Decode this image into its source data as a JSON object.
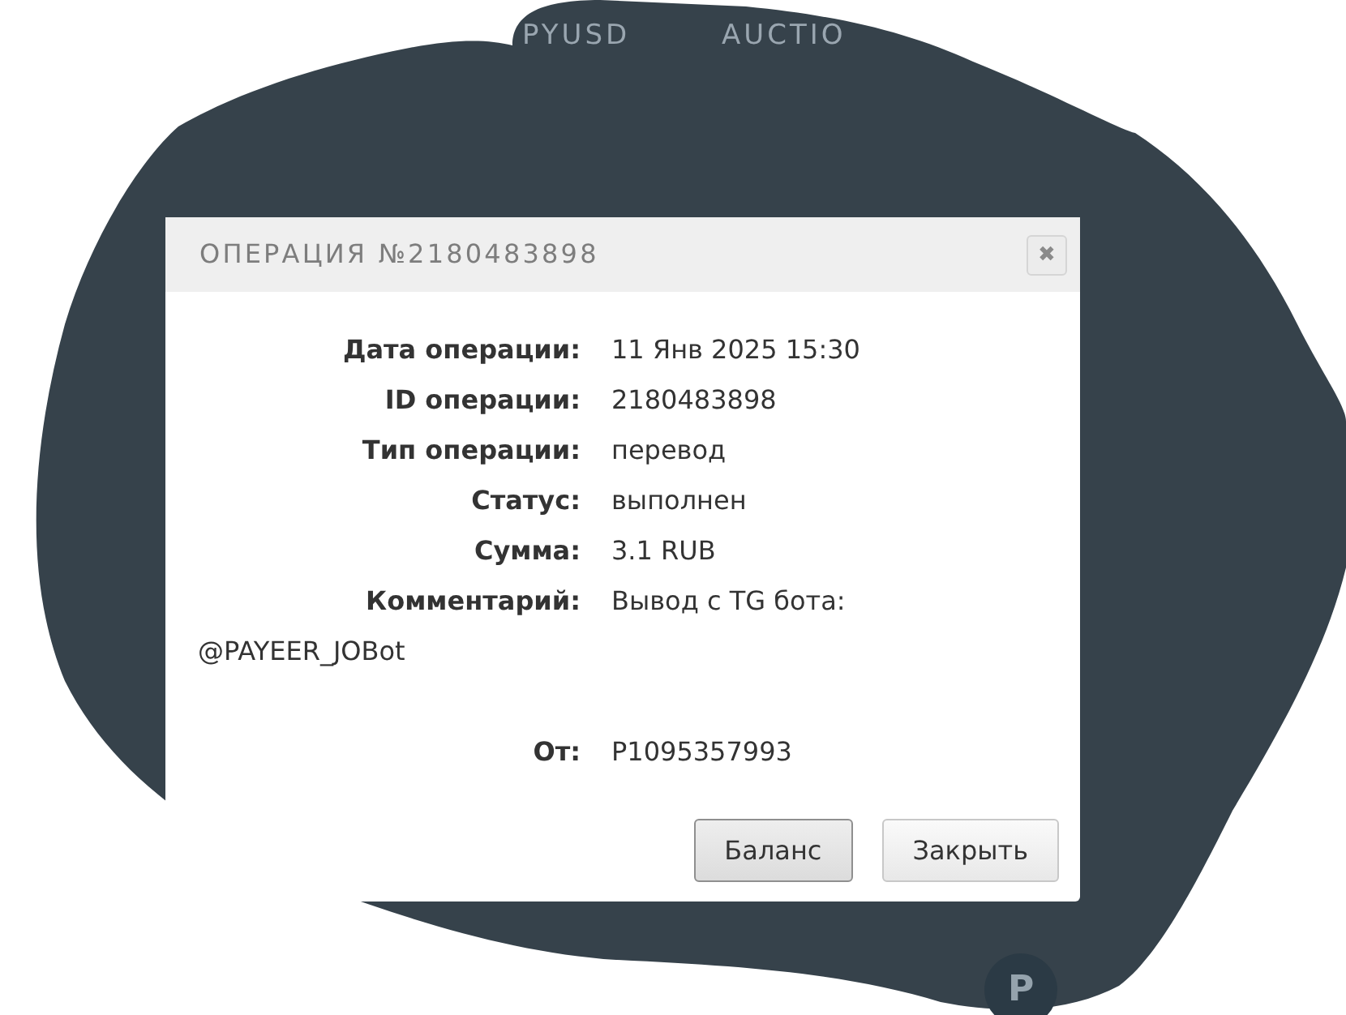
{
  "nav": [
    "PYUSD",
    "AUCTIO"
  ],
  "dialog": {
    "title": "ОПЕРАЦИЯ №2180483898",
    "close": "✖",
    "fields": [
      {
        "label": "Дата операции:",
        "value": "11 Янв 2025 15:30"
      },
      {
        "label": "ID операции:",
        "value": "2180483898"
      },
      {
        "label": "Тип операции:",
        "value": "перевод"
      },
      {
        "label": "Статус:",
        "value": "выполнен"
      },
      {
        "label": "Сумма:",
        "value": "3.1 RUB"
      },
      {
        "label": "Комментарий:",
        "value": "Вывод с TG бота:",
        "continuation": "@PAYEER_JOBot"
      },
      {
        "label": "От:",
        "value": "P1095357993"
      }
    ],
    "buttons": [
      {
        "label": "Баланс",
        "focused": true
      },
      {
        "label": "Закрыть",
        "focused": false
      }
    ]
  },
  "avatar": "P"
}
